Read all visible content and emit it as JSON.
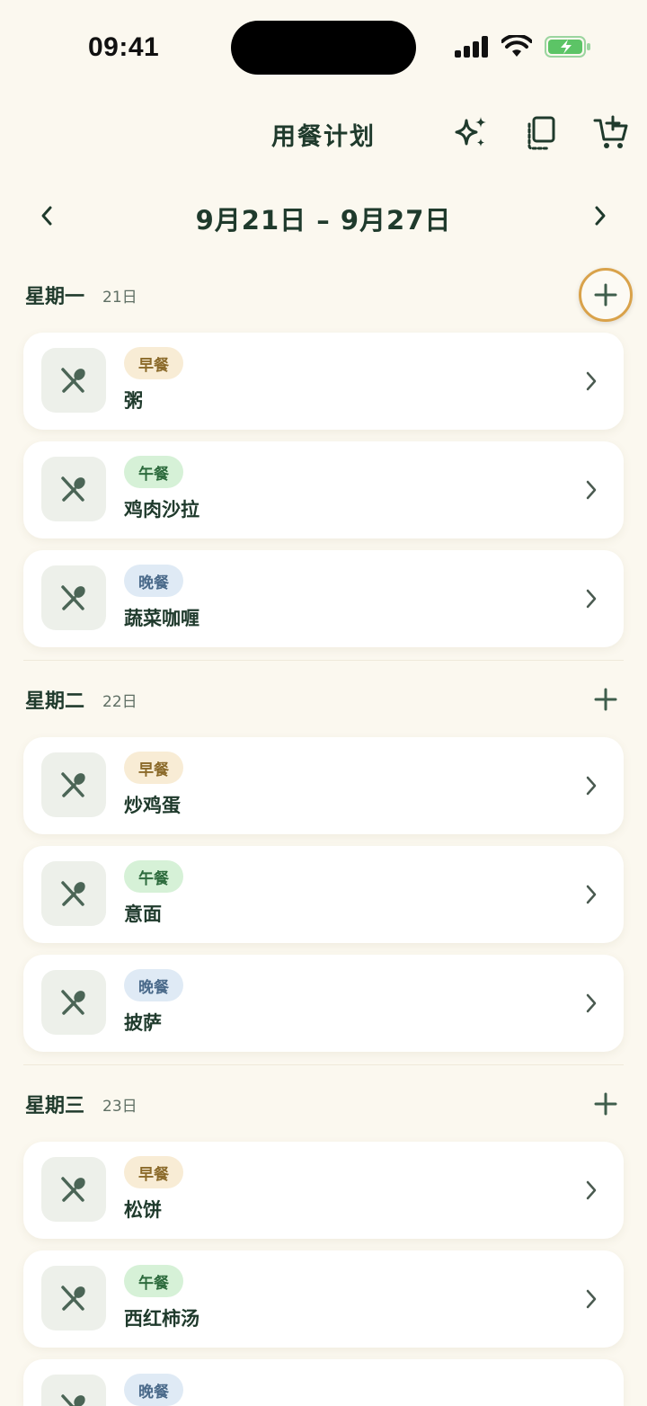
{
  "status": {
    "time": "09:41"
  },
  "header": {
    "title": "用餐计划"
  },
  "week": {
    "range": "9月21日 – 9月27日"
  },
  "days": [
    {
      "name": "星期一",
      "date": "21日",
      "meals": [
        {
          "type": "早餐",
          "name": "粥"
        },
        {
          "type": "午餐",
          "name": "鸡肉沙拉"
        },
        {
          "type": "晚餐",
          "name": "蔬菜咖喱"
        }
      ]
    },
    {
      "name": "星期二",
      "date": "22日",
      "meals": [
        {
          "type": "早餐",
          "name": "炒鸡蛋"
        },
        {
          "type": "午餐",
          "name": "意面"
        },
        {
          "type": "晚餐",
          "name": "披萨"
        }
      ]
    },
    {
      "name": "星期三",
      "date": "23日",
      "meals": [
        {
          "type": "早餐",
          "name": "松饼"
        },
        {
          "type": "午餐",
          "name": "西红柿汤"
        },
        {
          "type": "晚餐",
          "name": ""
        }
      ]
    }
  ],
  "colors": {
    "background": "#fbf8ef",
    "primary_text": "#1f3a2c",
    "accent_ring": "#d9a24a",
    "breakfast_badge": "#f8ecd5",
    "lunch_badge": "#d6f1d7",
    "dinner_badge": "#dfeaf5"
  },
  "icons": [
    "signal-icon",
    "wifi-icon",
    "battery-icon",
    "sparkle-icon",
    "copy-icon",
    "cart-icon",
    "chevron-left-icon",
    "chevron-right-icon",
    "plus-icon",
    "utensils-icon"
  ]
}
